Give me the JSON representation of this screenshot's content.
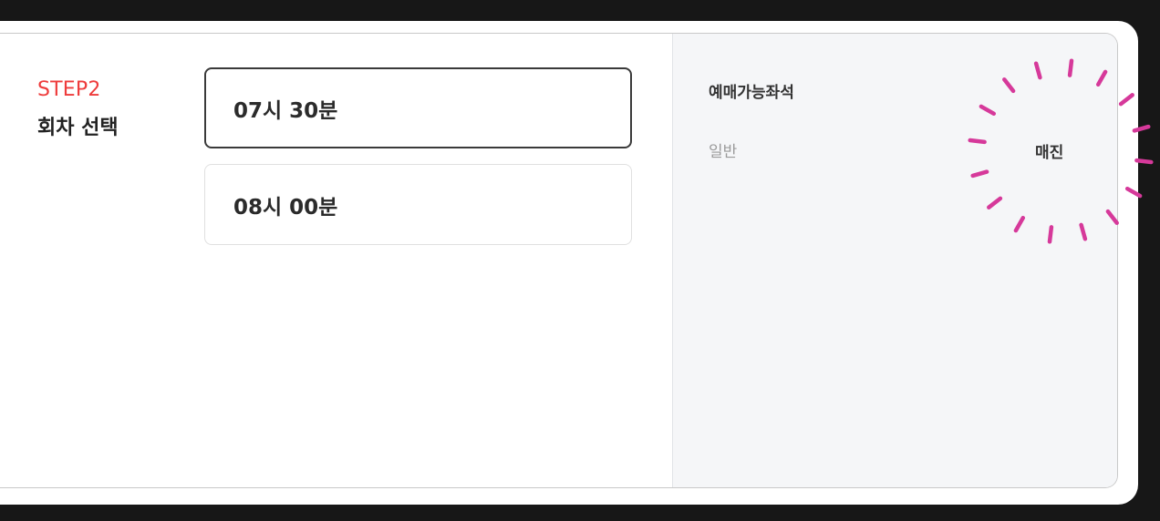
{
  "step": {
    "label": "STEP2",
    "title": "회차 선택"
  },
  "times": [
    {
      "label": "07시 30분",
      "selected": true
    },
    {
      "label": "08시 00분",
      "selected": false
    }
  ],
  "seats": {
    "title": "예매가능좌석",
    "rows": [
      {
        "grade": "일반",
        "status": "매진"
      }
    ]
  },
  "colors": {
    "step_accent": "#ee3b3b",
    "highlight": "#d6399a"
  }
}
